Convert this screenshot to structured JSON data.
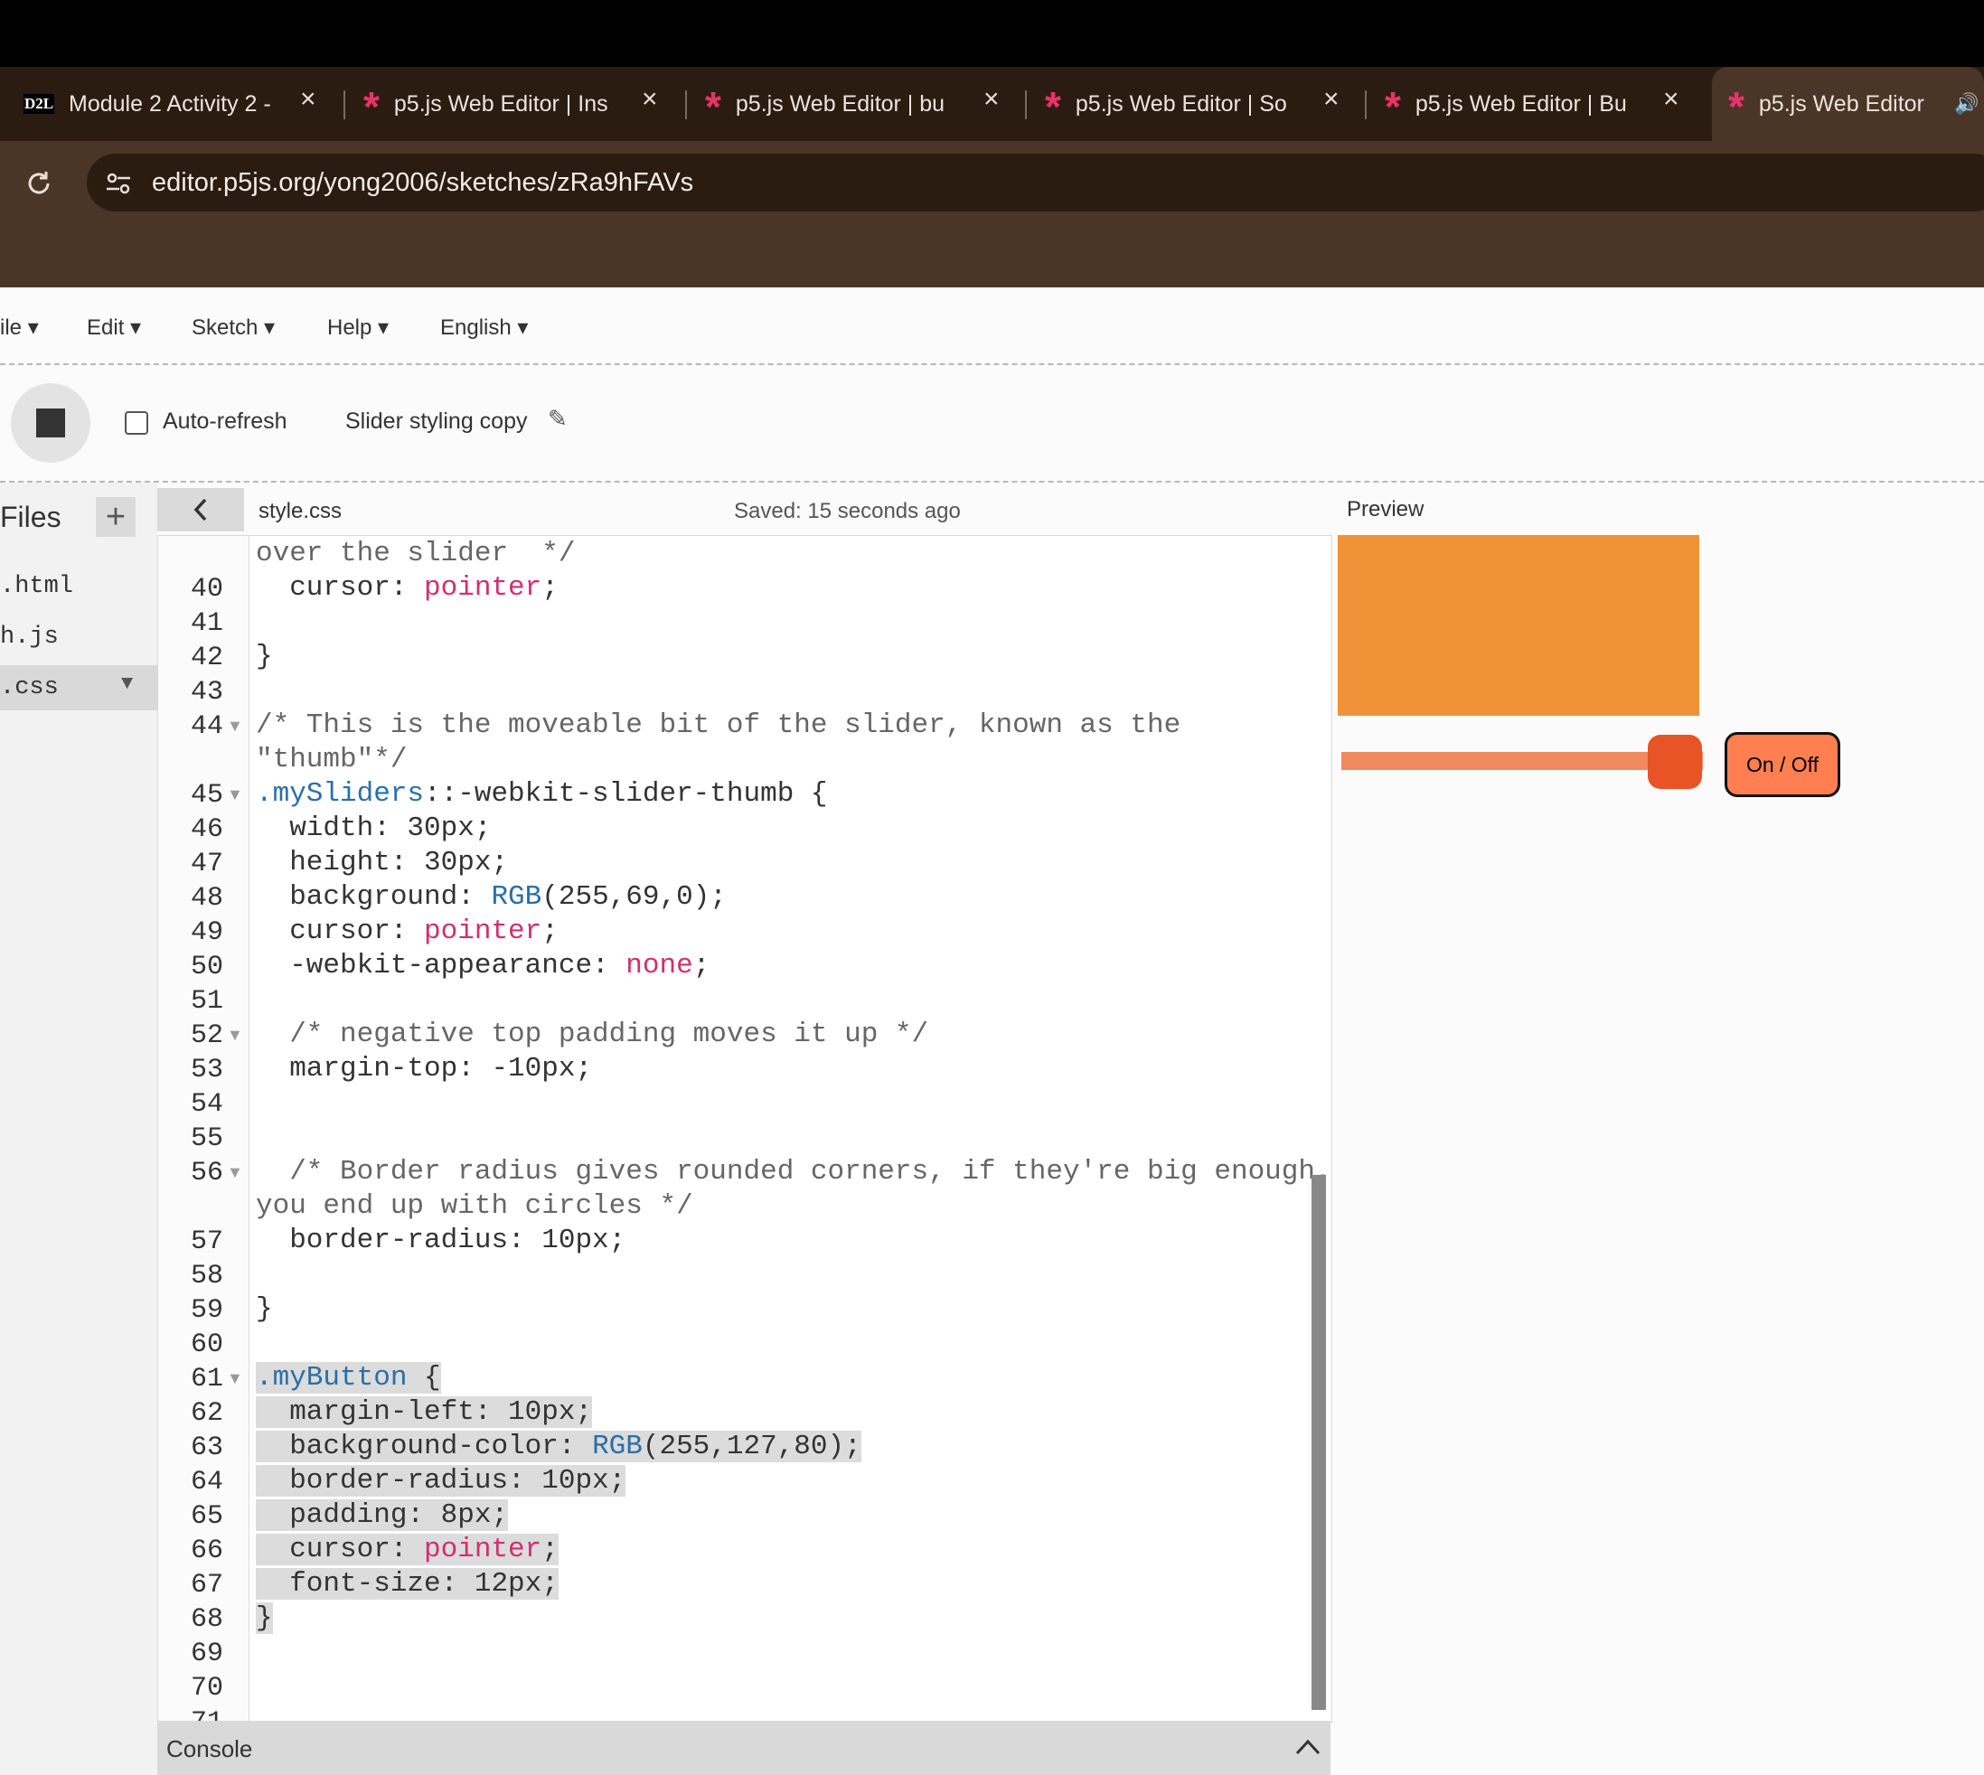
{
  "browser": {
    "tabs": [
      {
        "title": "Module 2 Activity 2 -",
        "icon": "d2l-icon",
        "icon_text": "D2L"
      },
      {
        "title": "p5.js Web Editor | Ins",
        "icon": "p5-star-icon"
      },
      {
        "title": "p5.js Web Editor | bu",
        "icon": "p5-star-icon"
      },
      {
        "title": "p5.js Web Editor | So",
        "icon": "p5-star-icon"
      },
      {
        "title": "p5.js Web Editor | Bu",
        "icon": "p5-star-icon"
      },
      {
        "title": "p5.js Web Editor",
        "icon": "p5-star-icon",
        "active": true
      }
    ],
    "close_glyph": "×",
    "url": "editor.p5js.org/yong2006/sketches/zRa9hFAVs"
  },
  "menu": {
    "items": [
      "ile",
      "Edit",
      "Sketch",
      "Help",
      "English"
    ]
  },
  "toolbar": {
    "auto_refresh_label": "Auto-refresh",
    "auto_refresh_checked": false,
    "sketch_name": "Slider styling copy"
  },
  "files": {
    "title": "Files",
    "add_glyph": "+",
    "items": [
      ".html",
      "h.js",
      ".css"
    ],
    "selected": ".css"
  },
  "editor": {
    "filename": "style.css",
    "saved_status": "Saved: 15 seconds ago",
    "lines": [
      {
        "n": "",
        "text": "over the slider  */"
      },
      {
        "n": "40",
        "text": "  cursor: pointer;"
      },
      {
        "n": "41",
        "text": ""
      },
      {
        "n": "42",
        "text": "}"
      },
      {
        "n": "43",
        "text": ""
      },
      {
        "n": "44",
        "text": "/* This is the moveable bit of the slider, known as the",
        "fold": true
      },
      {
        "n": "",
        "text": "\"thumb\"*/"
      },
      {
        "n": "45",
        "text": ".mySliders::-webkit-slider-thumb {",
        "fold": true
      },
      {
        "n": "46",
        "text": "  width: 30px;"
      },
      {
        "n": "47",
        "text": "  height: 30px;"
      },
      {
        "n": "48",
        "text": "  background: RGB(255,69,0);"
      },
      {
        "n": "49",
        "text": "  cursor: pointer;"
      },
      {
        "n": "50",
        "text": "  -webkit-appearance: none;"
      },
      {
        "n": "51",
        "text": ""
      },
      {
        "n": "52",
        "text": "  /* negative top padding moves it up */",
        "fold": true
      },
      {
        "n": "53",
        "text": "  margin-top: -10px;"
      },
      {
        "n": "54",
        "text": ""
      },
      {
        "n": "55",
        "text": ""
      },
      {
        "n": "56",
        "text": "  /* Border radius gives rounded corners, if they're big enough,",
        "fold": true
      },
      {
        "n": "",
        "text": "you end up with circles */"
      },
      {
        "n": "57",
        "text": "  border-radius: 10px;"
      },
      {
        "n": "58",
        "text": ""
      },
      {
        "n": "59",
        "text": "}"
      },
      {
        "n": "60",
        "text": ""
      },
      {
        "n": "61",
        "text": ".myButton {",
        "fold": true
      },
      {
        "n": "62",
        "text": "  margin-left: 10px;"
      },
      {
        "n": "63",
        "text": "  background-color: RGB(255,127,80);"
      },
      {
        "n": "64",
        "text": "  border-radius: 10px;"
      },
      {
        "n": "65",
        "text": "  padding: 8px;"
      },
      {
        "n": "66",
        "text": "  cursor: pointer;"
      },
      {
        "n": "67",
        "text": "  font-size: 12px;"
      },
      {
        "n": "68",
        "text": "}"
      },
      {
        "n": "69",
        "text": ""
      },
      {
        "n": "70",
        "text": ""
      },
      {
        "n": "71",
        "text": ""
      }
    ],
    "highlighted_lines": [
      "61",
      "62",
      "63",
      "64",
      "65",
      "66",
      "67",
      "68"
    ]
  },
  "console": {
    "label": "Console"
  },
  "preview": {
    "label": "Preview",
    "rect_color": "#f09338",
    "slider_value_fraction": 1.0,
    "slider_track_color": "#f28a60",
    "slider_thumb_color": "#e85426",
    "button_label": "On / Off",
    "button_color": "#ff7f50"
  }
}
